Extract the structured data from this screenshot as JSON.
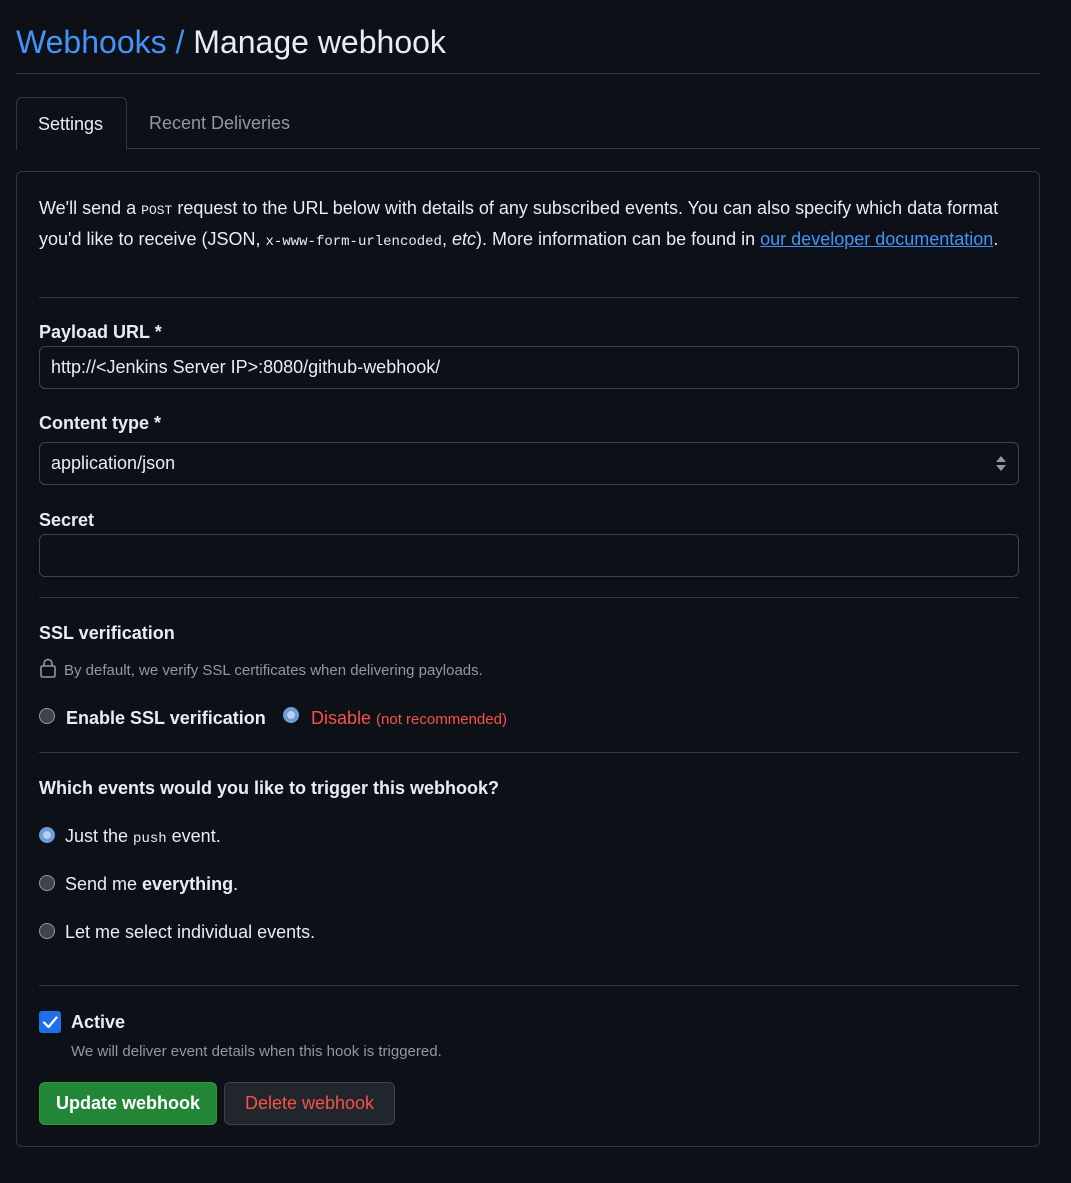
{
  "header": {
    "breadcrumb_link": "Webhooks",
    "breadcrumb_separator": "/",
    "title": "Manage webhook"
  },
  "tabs": [
    {
      "label": "Settings",
      "active": true
    },
    {
      "label": "Recent Deliveries",
      "active": false
    }
  ],
  "intro": {
    "part1": "We'll send a ",
    "post_code": "POST",
    "part2": " request to the URL below with details of any subscribed events. You can also specify which data format you'd like to receive (JSON, ",
    "form_code": "x-www-form-urlencoded",
    "part3": ", ",
    "etc": "etc",
    "part4": "). More information can be found in ",
    "link_text": "our developer documentation",
    "part5": "."
  },
  "payload_url": {
    "label": "Payload URL *",
    "value": "http://<Jenkins Server IP>:8080/github-webhook/"
  },
  "content_type": {
    "label": "Content type *",
    "selected": "application/json"
  },
  "secret": {
    "label": "Secret",
    "value": ""
  },
  "ssl": {
    "heading": "SSL verification",
    "note": "By default, we verify SSL certificates when delivering payloads.",
    "enable_label": "Enable SSL verification",
    "disable_label": "Disable",
    "disable_note": "(not recommended)",
    "selected": "disable"
  },
  "events": {
    "question": "Which events would you like to trigger this webhook?",
    "option1_pre": "Just the ",
    "option1_code": "push",
    "option1_post": " event.",
    "option2_pre": "Send me ",
    "option2_bold": "everything",
    "option2_post": ".",
    "option3": "Let me select individual events.",
    "selected": "push"
  },
  "active": {
    "label": "Active",
    "checked": true,
    "note": "We will deliver event details when this hook is triggered."
  },
  "buttons": {
    "update": "Update webhook",
    "delete": "Delete webhook"
  },
  "colors": {
    "background": "#0d1117",
    "link": "#4493f8",
    "primary_button": "#238636",
    "danger": "#f85149",
    "border": "#30363d"
  }
}
